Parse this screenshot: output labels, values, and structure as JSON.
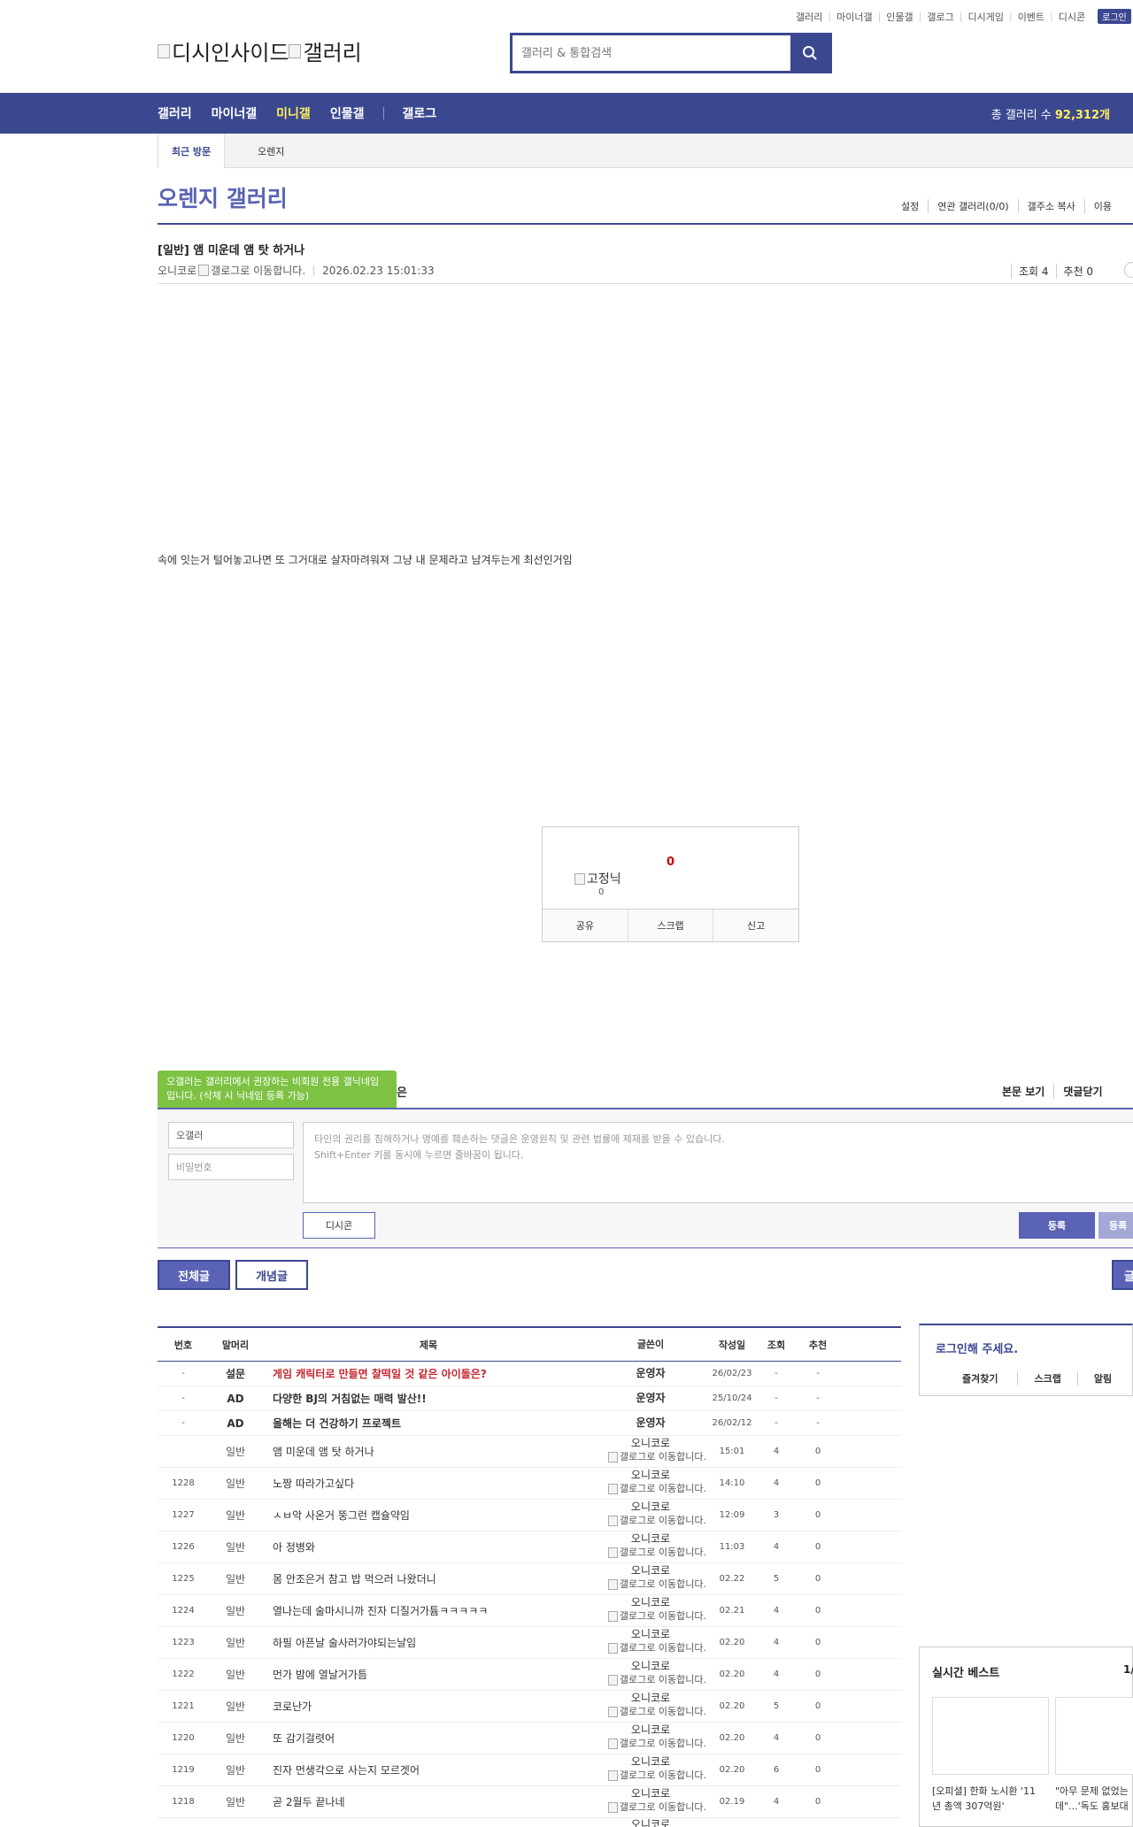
{
  "top_links": [
    "갤러리",
    "마이너갤",
    "인물갤",
    "갤로그",
    "디시게임",
    "이벤트",
    "디시콘"
  ],
  "login_label": "로그인",
  "logo": {
    "left_alt": "디시인사이드",
    "right_alt": "갤러리"
  },
  "search": {
    "placeholder": "갤러리 & 통합검색"
  },
  "gnb": {
    "items": [
      "갤러리",
      "마이너갤",
      "미니갤",
      "인물갤",
      "갤로그"
    ],
    "total_label": "총 갤러리 수",
    "total_value": "92,312개"
  },
  "recent": {
    "label": "최근 방문",
    "visited": "오렌지"
  },
  "gallery": {
    "title": "오렌지 갤러리",
    "menu": [
      "설정",
      "연관 갤러리(0/0)",
      "갤주소 복사",
      "이용"
    ]
  },
  "post": {
    "title": "[일반] 앰 미운데 앰 탓 하거나",
    "writer": "오니코로",
    "writer_img_alt": "갤로그로 이동합니다.",
    "date": "2026.02.23 15:01:33",
    "views": "조회 4",
    "recommend": "추천 0",
    "body": "속에 잇는거 털어놓고나면 또 그거대로 살자마려워져 그냥 내 문제라고 남겨두는게 최선인거임"
  },
  "recommend_box": {
    "count": "0",
    "fixed_alt": "고정닉",
    "fixed_count": "0",
    "buttons": [
      "공유",
      "스크랩",
      "신고"
    ]
  },
  "comments": {
    "tooltip": "오갤러는 갤러리에서 권장하는 비회원 전용 갤닉네임입니다. (삭제 시 닉네임 등록 가능)",
    "tooltip_tail": "은",
    "view_links": [
      "본문 보기",
      "댓글닫기"
    ],
    "name_value": "오갤러",
    "password_placeholder": "비밀번호",
    "textarea_line1": "타인의 권리를 침해하거나 명예를 훼손하는 댓글은 운영원칙 및 관련 법률에 제재를 받을 수 있습니다.",
    "textarea_line2": "Shift+Enter 키를 동시에 누르면 줄바꿈이 됩니다.",
    "dccon_label": "디시콘",
    "register_label": "등록",
    "register2_label": "등록"
  },
  "tabs": {
    "all": "전체글",
    "concept": "개념글",
    "right_initial": "글"
  },
  "list": {
    "headers": {
      "no": "번호",
      "head": "말머리",
      "subject": "제목",
      "writer": "글쓴이",
      "date": "작성일",
      "views": "조회",
      "recommend": "추천"
    },
    "notices": [
      {
        "no": "-",
        "head": "설문",
        "subject": "게임 캐릭터로 만들면 찰떡일 것 같은 아이돌은?",
        "writer": "운영자",
        "date": "26/02/23",
        "views": "-",
        "recommend": "-"
      },
      {
        "no": "-",
        "head": "AD",
        "subject": "다양한 BJ의 거침없는 매력 발산!!",
        "writer": "운영자",
        "date": "25/10/24",
        "views": "-",
        "recommend": "-"
      },
      {
        "no": "-",
        "head": "AD",
        "subject": "올해는 더 건강하기 프로젝트",
        "writer": "운영자",
        "date": "26/02/12",
        "views": "-",
        "recommend": "-"
      }
    ],
    "writer_img_alt": "갤로그로 이동합니다.",
    "rows": [
      {
        "no": "",
        "head": "일반",
        "subject": "앰 미운데 앰 탓 하거나",
        "writer": "오니코로",
        "date": "15:01",
        "views": "4",
        "recommend": "0"
      },
      {
        "no": "1228",
        "head": "일반",
        "subject": "노짱 따라가고싶다",
        "writer": "오니코로",
        "date": "14:10",
        "views": "4",
        "recommend": "0"
      },
      {
        "no": "1227",
        "head": "일반",
        "subject": "ㅅㅂ악 사온거 뚱그런 캡슐약임",
        "writer": "오니코로",
        "date": "12:09",
        "views": "3",
        "recommend": "0"
      },
      {
        "no": "1226",
        "head": "일반",
        "subject": "아 정병와",
        "writer": "오니코로",
        "date": "11:03",
        "views": "4",
        "recommend": "0"
      },
      {
        "no": "1225",
        "head": "일반",
        "subject": "몸 안조은거 참고 밥 먹으러 나왔더니",
        "writer": "오니코로",
        "date": "02.22",
        "views": "5",
        "recommend": "0"
      },
      {
        "no": "1224",
        "head": "일반",
        "subject": "열나는데 술마시니까 진자 디질거가튬ㅋㅋㅋㅋㅋ",
        "writer": "오니코로",
        "date": "02.21",
        "views": "4",
        "recommend": "0"
      },
      {
        "no": "1223",
        "head": "일반",
        "subject": "하필 아픈날 술사러가야되는날임",
        "writer": "오니코로",
        "date": "02.20",
        "views": "4",
        "recommend": "0"
      },
      {
        "no": "1222",
        "head": "일반",
        "subject": "먼가 밤에 열날거가틈",
        "writer": "오니코로",
        "date": "02.20",
        "views": "4",
        "recommend": "0"
      },
      {
        "no": "1221",
        "head": "일반",
        "subject": "코로난가",
        "writer": "오니코로",
        "date": "02.20",
        "views": "5",
        "recommend": "0"
      },
      {
        "no": "1220",
        "head": "일반",
        "subject": "또 감기걸렷어",
        "writer": "오니코로",
        "date": "02.20",
        "views": "4",
        "recommend": "0"
      },
      {
        "no": "1219",
        "head": "일반",
        "subject": "진자 먼생각으로 사는지 모르겟어",
        "writer": "오니코로",
        "date": "02.20",
        "views": "6",
        "recommend": "0"
      },
      {
        "no": "1218",
        "head": "일반",
        "subject": "곧 2월두 끝나네",
        "writer": "오니코로",
        "date": "02.19",
        "views": "4",
        "recommend": "0"
      }
    ],
    "last_partial_writer": "오니코로"
  },
  "side": {
    "login_prompt": "로그인해 주세요.",
    "login_links": [
      "즐겨찾기",
      "스크랩",
      "알림"
    ],
    "best_title": "실시간 베스트",
    "best_page": "1/",
    "best_items": [
      {
        "caption1": "[오피셜] 한화 노시환 '11",
        "caption2": "년 총액 307억원'"
      },
      {
        "caption1": "\"아무 문제 없었는",
        "caption2": "데\"...'독도 홍보대"
      }
    ]
  },
  "colors": {
    "primary": "#3b4890",
    "accent": "#5a63b5",
    "highlight": "#ffef5c",
    "notice_red": "#c4262e",
    "tooltip_green": "#7dc243"
  }
}
